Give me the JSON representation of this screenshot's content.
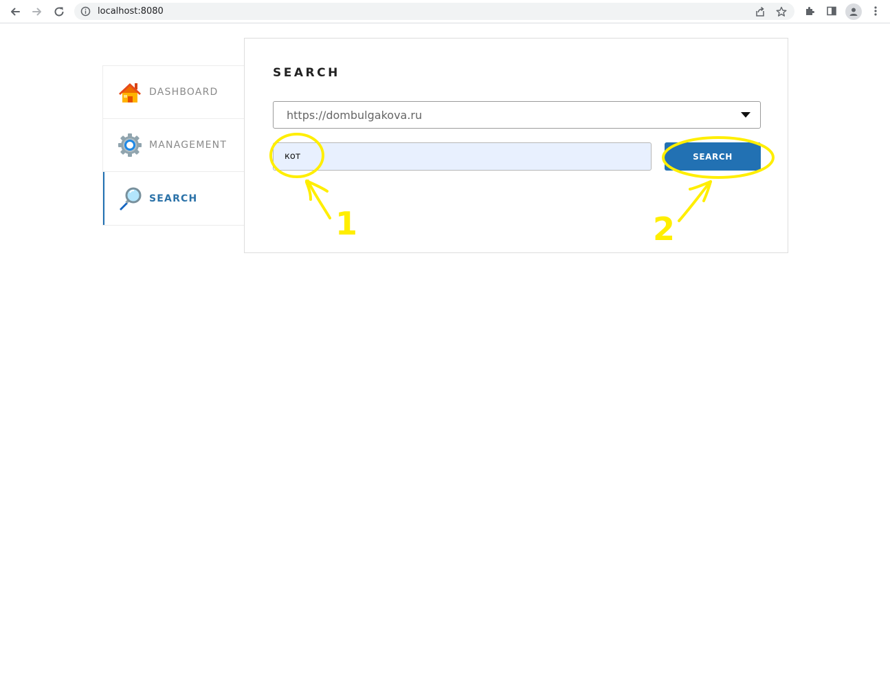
{
  "browser": {
    "url": "localhost:8080",
    "icons": [
      "back-icon",
      "forward-icon",
      "reload-icon",
      "site-info-icon",
      "share-icon",
      "bookmark-star-icon",
      "extensions-icon",
      "side-panel-icon",
      "profile-icon",
      "menu-icon"
    ]
  },
  "sidebar": {
    "items": [
      {
        "label": "DASHBOARD",
        "icon": "house-icon",
        "active": false
      },
      {
        "label": "MANAGEMENT",
        "icon": "gear-icon",
        "active": false
      },
      {
        "label": "SEARCH",
        "icon": "magnifier-icon",
        "active": true
      }
    ]
  },
  "main": {
    "title": "SEARCH",
    "site_select": {
      "selected": "https://dombulgakova.ru"
    },
    "query_input": {
      "value": "кот"
    },
    "search_button": "SEARCH"
  },
  "annotations": {
    "step1": "1",
    "step2": "2",
    "color": "#ffee00"
  },
  "colors": {
    "accent": "#2271b3",
    "input_bg": "#e8f0fe",
    "annotation": "#ffee00"
  }
}
